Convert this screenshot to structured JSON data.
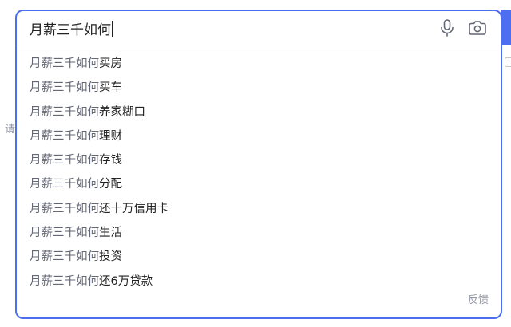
{
  "search": {
    "query": "月薪三千如何",
    "mic_icon": "microphone-icon",
    "camera_icon": "camera-icon"
  },
  "side": {
    "left_char": "请"
  },
  "suggestions": [
    {
      "prefix": "月薪三千如何",
      "suffix": "买房"
    },
    {
      "prefix": "月薪三千如何",
      "suffix": "买车"
    },
    {
      "prefix": "月薪三千如何",
      "suffix": "养家糊口"
    },
    {
      "prefix": "月薪三千如何",
      "suffix": "理财"
    },
    {
      "prefix": "月薪三千如何",
      "suffix": "存钱"
    },
    {
      "prefix": "月薪三千如何",
      "suffix": "分配"
    },
    {
      "prefix": "月薪三千如何",
      "suffix": "还十万信用卡"
    },
    {
      "prefix": "月薪三千如何",
      "suffix": "生活"
    },
    {
      "prefix": "月薪三千如何",
      "suffix": "投资"
    },
    {
      "prefix": "月薪三千如何",
      "suffix": "还6万贷款"
    }
  ],
  "feedback_label": "反馈",
  "colors": {
    "accent": "#4e6ef2",
    "prefix_text": "#626675",
    "suffix_text": "#222222",
    "muted": "#9195a3"
  }
}
